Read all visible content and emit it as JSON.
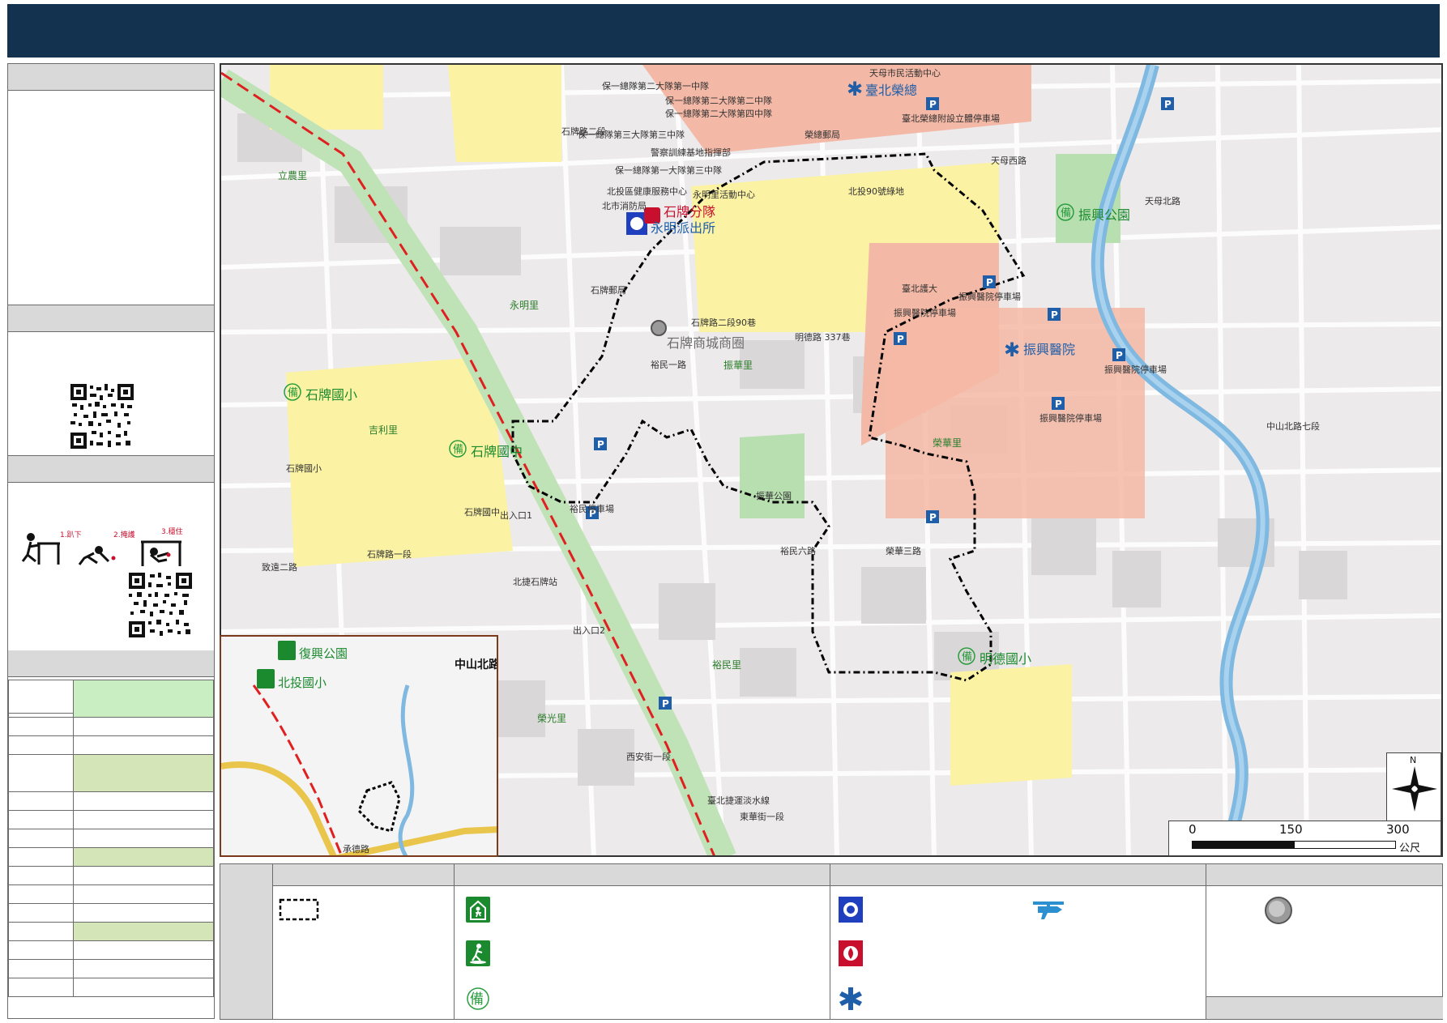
{
  "colors": {
    "title_bar": "#12324f",
    "boundary": "#000000",
    "rail_line": "#e02020",
    "school_zone": "#fbf3a3",
    "hospital_zone": "#f4b8a6",
    "park_green": "#9fd39a",
    "river": "#7fb8e0",
    "evac_green": "#1b8a2f",
    "police_blue": "#1f3fbf",
    "fire_red": "#c8102e",
    "medical_blue": "#1f5ea8",
    "table_green_a": "#c9eec2",
    "table_green_b": "#d4e6b8"
  },
  "map": {
    "named_features": [
      {
        "name": "臺北榮總",
        "icon": "medical-icon"
      },
      {
        "name": "振興醫院",
        "icon": "medical-icon"
      },
      {
        "name": "石牌分隊",
        "icon": "fire-station-icon"
      },
      {
        "name": "永明派出所",
        "icon": "police-icon"
      },
      {
        "name": "石牌商城商圈",
        "icon": "shopping-district-icon"
      },
      {
        "name": "石牌國小",
        "icon": "shelter-icon"
      },
      {
        "name": "石牌國中",
        "icon": "shelter-icon"
      },
      {
        "name": "振興公園",
        "icon": "shelter-icon"
      },
      {
        "name": "明德國小",
        "icon": "shelter-icon"
      }
    ],
    "labels": {
      "rongzong": "臺北榮總",
      "zhenxing_hospital": "振興醫院",
      "shipai_fire": "石牌分隊",
      "yongming_police": "永明派出所",
      "shopping": "石牌商城商圈",
      "shipai_elem": "石牌國小",
      "shipai_junior": "石牌國中",
      "zhenxing_park": "振興公園",
      "mingde_elem": "明德國小",
      "zhenxing_parking_1": "振興醫院停車場",
      "zhenxing_parking_2": "振興醫院停車場",
      "zhenxing_parking_3": "振興醫院停車場",
      "zhenxing_parking_4": "振興醫院停車場",
      "rongzong_parking": "臺北榮總附設立體停車場",
      "rongzong_post": "榮總郵局",
      "north_health": "北投區健康服務中心",
      "fire_bureau": "北市消防局",
      "yongming_activity": "永明里活動中心",
      "shipai_post": "石牌郵局",
      "taipei_univ": "北投90號綠地",
      "taipei_nurse": "臺北護大",
      "mingde_rd": "明德路 337巷",
      "shipai_rd_2": "石牌路二段90巷",
      "shipai_rd_2b": "石牌路二段",
      "yumin_rd": "裕民一路",
      "yumin6": "裕民六路",
      "rongde": "榮華三路",
      "tianmu_w": "天母西路",
      "tianmu_n": "天母北路",
      "zhongshan_n7": "中山北路七段",
      "shipai_station": "北捷石牌站",
      "exit1": "出入口1",
      "exit2": "出入口2",
      "baoyi_1": "保一總隊第二大隊第一中隊",
      "baoyi_2": "保一總隊第二大隊第二中隊",
      "baoyi_3": "保一總隊第二大隊第四中隊",
      "baoyi_4": "保一總隊第三大隊第三中隊",
      "baoyi_5": "保一總隊第一大隊第三中隊",
      "police_training": "警察訓練基地指揮部",
      "lisheng_li": "立農里",
      "yongming_li": "永明里",
      "zhenhua_li": "振華里",
      "rongguang_li": "榮光里",
      "yuming_li": "裕民里",
      "jili_li": "吉利里",
      "ronghua_li": "榮華里",
      "zhenhua_park": "振華公園",
      "yumin_parking": "裕民停車場",
      "shipai_junior_label": "石牌國中",
      "shipai_elem_label": "石牌國小",
      "dongguan_rd": "東華街一段",
      "xian_st": "西安街一段",
      "zhiyuan_rd": "致遠二路",
      "shipai_rd_1": "石牌路一段",
      "rail": "臺北捷運淡水線",
      "tianmu_parking": "天母市民活動中心",
      "fuxing_park": "復興公園",
      "beitou_elem": "北投國小",
      "zhongshan_n_inset": "中山北路",
      "xide_rd": "承德路"
    }
  },
  "scale": {
    "ticks": [
      "0",
      "150",
      "300"
    ],
    "unit": "公尺"
  },
  "north": {
    "letter": "N"
  },
  "side": {
    "qr_icon": "qr-code-icon",
    "posture_icon": "drop-cover-hold-icon",
    "posture_steps": [
      "1.趴下",
      "2.掩護",
      "3.穩住"
    ]
  },
  "legend": {
    "boundary_icon": "dashed-boundary-icon",
    "shelter_icon": "evacuation-shelter-icon",
    "park_icon": "evacuation-park-icon",
    "ready_icon": "standby-shelter-icon",
    "police_icon": "police-icon",
    "fire_icon": "fire-station-icon",
    "medical_icon": "medical-icon",
    "helipad_icon": "helicopter-icon",
    "district_icon": "shopping-district-icon",
    "ready_char": "備"
  }
}
